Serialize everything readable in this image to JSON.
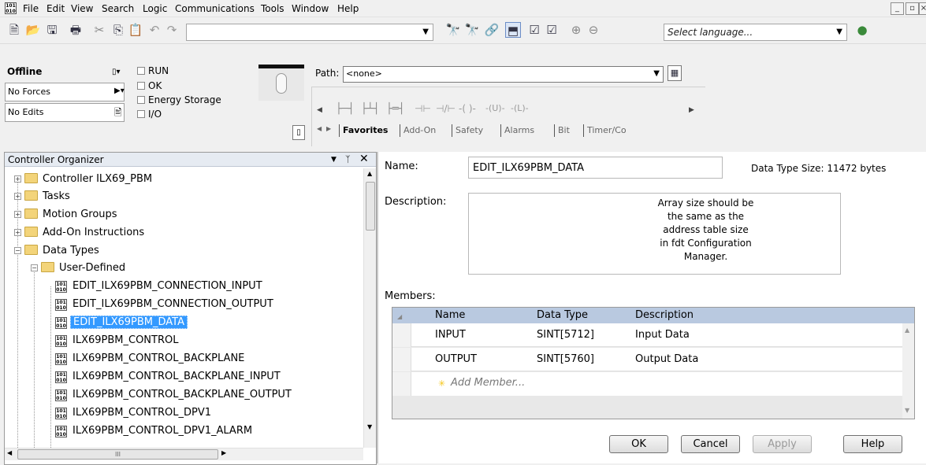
{
  "menu": [
    "File",
    "Edit",
    "View",
    "Search",
    "Logic",
    "Communications",
    "Tools",
    "Window",
    "Help"
  ],
  "toolbar": {
    "select_language_placeholder": "Select language..."
  },
  "status": {
    "mode": "Offline",
    "forces": "No Forces",
    "edits": "No Edits",
    "indicators": [
      "RUN",
      "OK",
      "Energy Storage",
      "I/O"
    ]
  },
  "path": {
    "label": "Path:",
    "value": "<none>"
  },
  "instruction_tabs": [
    "Favorites",
    "Add-On",
    "Safety",
    "Alarms",
    "Bit",
    "Timer/Co"
  ],
  "organizer": {
    "title": "Controller Organizer",
    "tree": [
      {
        "label": "Controller ILX69_PBM",
        "kind": "folder",
        "expander": "+"
      },
      {
        "label": "Tasks",
        "kind": "folder",
        "expander": "+"
      },
      {
        "label": "Motion Groups",
        "kind": "folder",
        "expander": "+"
      },
      {
        "label": "Add-On Instructions",
        "kind": "folder",
        "expander": "+"
      },
      {
        "label": "Data Types",
        "kind": "folder",
        "expander": "-"
      },
      {
        "label": "User-Defined",
        "kind": "folder",
        "expander": "-"
      },
      {
        "label": "EDIT_ILX69PBM_CONNECTION_INPUT",
        "kind": "datatype"
      },
      {
        "label": "EDIT_ILX69PBM_CONNECTION_OUTPUT",
        "kind": "datatype"
      },
      {
        "label": "EDIT_ILX69PBM_DATA",
        "kind": "datatype",
        "selected": true
      },
      {
        "label": "ILX69PBM_CONTROL",
        "kind": "datatype"
      },
      {
        "label": "ILX69PBM_CONTROL_BACKPLANE",
        "kind": "datatype"
      },
      {
        "label": "ILX69PBM_CONTROL_BACKPLANE_INPUT",
        "kind": "datatype"
      },
      {
        "label": "ILX69PBM_CONTROL_BACKPLANE_OUTPUT",
        "kind": "datatype"
      },
      {
        "label": "ILX69PBM_CONTROL_DPV1",
        "kind": "datatype"
      },
      {
        "label": "ILX69PBM_CONTROL_DPV1_ALARM",
        "kind": "datatype"
      }
    ],
    "scroll_glyph": "III"
  },
  "editor": {
    "name_label": "Name:",
    "name_value": "EDIT_ILX69PBM_DATA",
    "size_text": "Data Type Size: 11472 bytes",
    "description_label": "Description:",
    "description_lines": [
      "Array size should be",
      "the same as the",
      "address table size",
      "in fdt Configuration",
      "Manager."
    ],
    "members_label": "Members:",
    "columns": [
      "Name",
      "Data Type",
      "Description"
    ],
    "rows": [
      {
        "name": "INPUT",
        "type": "SINT[5712]",
        "desc": "Input Data"
      },
      {
        "name": "OUTPUT",
        "type": "SINT[5760]",
        "desc": "Output Data"
      }
    ],
    "add_member": "Add Member...",
    "buttons": [
      "OK",
      "Cancel",
      "Apply",
      "Help"
    ]
  },
  "colors": {
    "selection": "#3399ff",
    "table_header": "#b9c9e0"
  }
}
